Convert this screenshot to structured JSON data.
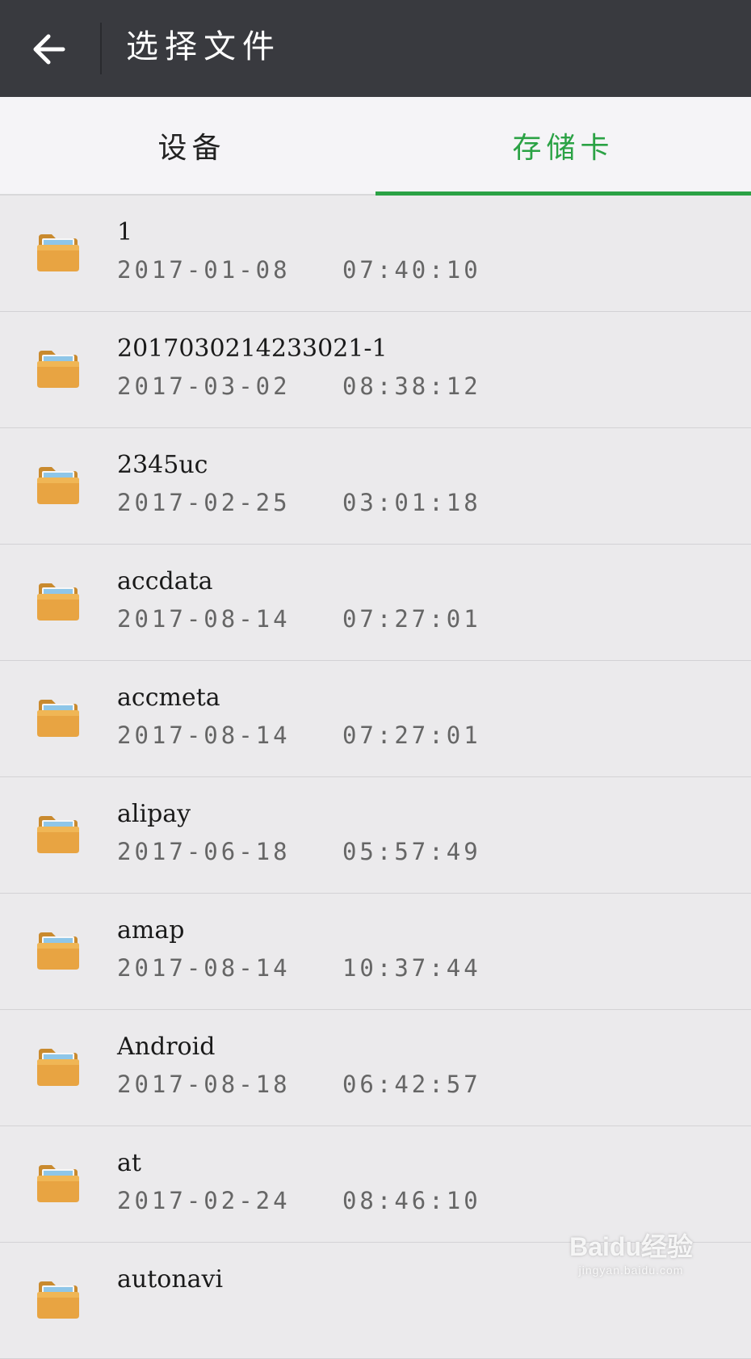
{
  "header": {
    "title": "选择文件",
    "back_icon": "arrow-left-icon"
  },
  "tabs": [
    {
      "label": "设备",
      "active": false
    },
    {
      "label": "存储卡",
      "active": true
    }
  ],
  "colors": {
    "appbar": "#393a3f",
    "accent": "#2ba245",
    "folder": "#e3a03e"
  },
  "files": [
    {
      "name": "1",
      "date": "2017-01-08   07:40:10"
    },
    {
      "name": "20170302142330​21-1",
      "date": "2017-03-02   08:38:12"
    },
    {
      "name": "2345uc",
      "date": "2017-02-25   03:01:18"
    },
    {
      "name": "accdata",
      "date": "2017-08-14   07:27:01"
    },
    {
      "name": "accmeta",
      "date": "2017-08-14   07:27:01"
    },
    {
      "name": "alipay",
      "date": "2017-06-18   05:57:49"
    },
    {
      "name": "amap",
      "date": "2017-08-14   10:37:44"
    },
    {
      "name": "Android",
      "date": "2017-08-18   06:42:57"
    },
    {
      "name": "at",
      "date": "2017-02-24   08:46:10"
    },
    {
      "name": "autonavi",
      "date": ""
    }
  ],
  "watermark": {
    "brand": "Baidu经验",
    "site": "jingyan.baidu.com"
  }
}
